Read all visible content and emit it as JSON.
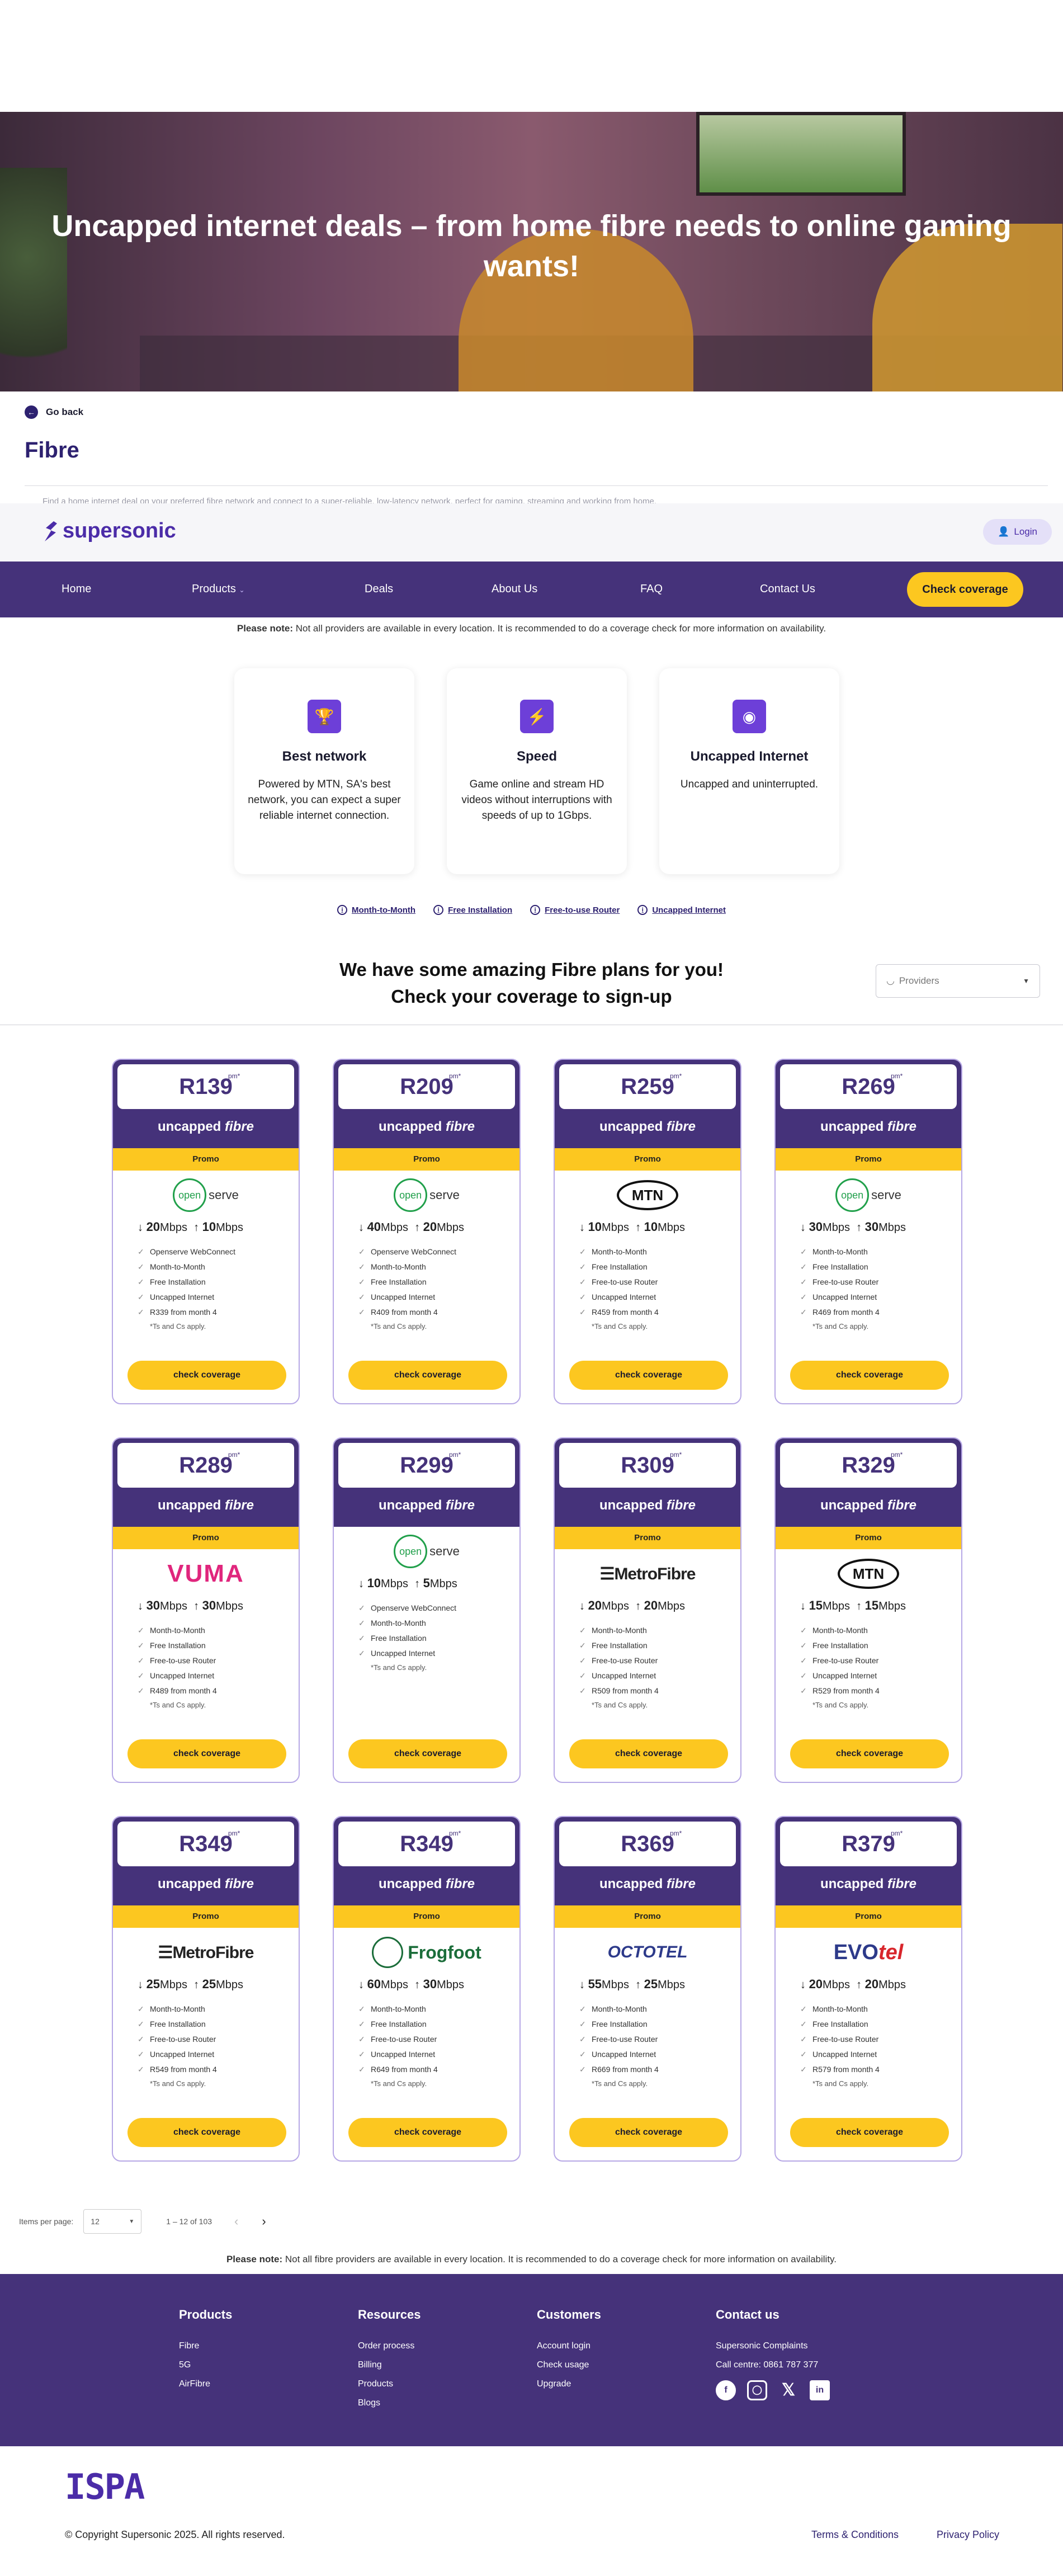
{
  "hero": {
    "title": "Uncapped internet deals – from home fibre needs to online gaming wants!"
  },
  "back": {
    "label": "Go back"
  },
  "page": {
    "title": "Fibre",
    "intro": "Find a home internet deal on your preferred fibre network and connect to a super-reliable, low-latency network, perfect for gaming, streaming and working from home."
  },
  "header": {
    "brand": "supersonic",
    "login": "Login",
    "nav": [
      "Home",
      "Products",
      "Deals",
      "About Us",
      "FAQ",
      "Contact Us"
    ],
    "cta": "Check coverage"
  },
  "note": {
    "strong": "Please note:",
    "text": " Not all providers are available in every location. It is recommended to do a coverage check for more information on availability."
  },
  "features": [
    {
      "icon": "trophy-icon",
      "title": "Best network",
      "text": "Powered by MTN, SA's best network, you can expect a super reliable internet connection."
    },
    {
      "icon": "lightning-icon",
      "title": "Speed",
      "text": "Game online and stream HD videos without interruptions with speeds of up to 1Gbps."
    },
    {
      "icon": "camera-icon",
      "title": "Uncapped Internet",
      "text": "Uncapped and uninterrupted."
    }
  ],
  "badges": [
    "Month-to-Month",
    "Free Installation",
    "Free-to-use Router",
    "Uncapped Internet"
  ],
  "plans_heading": {
    "line1": "We have some amazing Fibre plans for you!",
    "line2": "Check your coverage to sign-up"
  },
  "filter": {
    "placeholder": "Providers"
  },
  "card_common": {
    "plan": "uncapped",
    "plan_em": "fibre",
    "promo": "Promo",
    "cta": "check coverage",
    "pm": "pm*",
    "tcs": "*Ts and Cs apply."
  },
  "cards": [
    {
      "price": "R139",
      "provider": "openserve",
      "down": "20",
      "up": "10",
      "promo": true,
      "features": [
        "Openserve WebConnect",
        "Month-to-Month",
        "Free Installation",
        "Uncapped Internet",
        "R339 from month 4"
      ]
    },
    {
      "price": "R209",
      "provider": "openserve",
      "down": "40",
      "up": "20",
      "promo": true,
      "features": [
        "Openserve WebConnect",
        "Month-to-Month",
        "Free Installation",
        "Uncapped Internet",
        "R409 from month 4"
      ]
    },
    {
      "price": "R259",
      "provider": "mtn",
      "down": "10",
      "up": "10",
      "promo": true,
      "features": [
        "Month-to-Month",
        "Free Installation",
        "Free-to-use Router",
        "Uncapped Internet",
        "R459 from month 4"
      ]
    },
    {
      "price": "R269",
      "provider": "openserve",
      "down": "30",
      "up": "30",
      "promo": true,
      "features": [
        "Month-to-Month",
        "Free Installation",
        "Free-to-use Router",
        "Uncapped Internet",
        "R469 from month 4"
      ]
    },
    {
      "price": "R289",
      "provider": "vuma",
      "down": "30",
      "up": "30",
      "promo": true,
      "features": [
        "Month-to-Month",
        "Free Installation",
        "Free-to-use Router",
        "Uncapped Internet",
        "R489 from month 4"
      ]
    },
    {
      "price": "R299",
      "provider": "openserve",
      "down": "10",
      "up": "5",
      "promo": false,
      "features": [
        "Openserve WebConnect",
        "Month-to-Month",
        "Free Installation",
        "Uncapped Internet"
      ]
    },
    {
      "price": "R309",
      "provider": "metrofibre",
      "down": "20",
      "up": "20",
      "promo": true,
      "features": [
        "Month-to-Month",
        "Free Installation",
        "Free-to-use Router",
        "Uncapped Internet",
        "R509 from month 4"
      ]
    },
    {
      "price": "R329",
      "provider": "mtn",
      "down": "15",
      "up": "15",
      "promo": true,
      "features": [
        "Month-to-Month",
        "Free Installation",
        "Free-to-use Router",
        "Uncapped Internet",
        "R529 from month 4"
      ]
    },
    {
      "price": "R349",
      "provider": "metrofibre",
      "down": "25",
      "up": "25",
      "promo": true,
      "features": [
        "Month-to-Month",
        "Free Installation",
        "Free-to-use Router",
        "Uncapped Internet",
        "R549 from month 4"
      ]
    },
    {
      "price": "R349",
      "provider": "frogfoot",
      "down": "60",
      "up": "30",
      "promo": true,
      "features": [
        "Month-to-Month",
        "Free Installation",
        "Free-to-use Router",
        "Uncapped Internet",
        "R649 from month 4"
      ]
    },
    {
      "price": "R369",
      "provider": "octotel",
      "down": "55",
      "up": "25",
      "promo": true,
      "features": [
        "Month-to-Month",
        "Free Installation",
        "Free-to-use Router",
        "Uncapped Internet",
        "R669 from month 4"
      ]
    },
    {
      "price": "R379",
      "provider": "evotel",
      "down": "20",
      "up": "20",
      "promo": true,
      "features": [
        "Month-to-Month",
        "Free Installation",
        "Free-to-use Router",
        "Uncapped Internet",
        "R579 from month 4"
      ]
    }
  ],
  "logos": {
    "openserve_ring": "open",
    "openserve_text": "serve",
    "mtn": "MTN",
    "vuma": "VUMA",
    "metrofibre": "MetroFibre",
    "frogfoot": "Frogfoot",
    "octotel": "OCTOTEL",
    "evotel_a": "EVO",
    "evotel_b": "tel"
  },
  "unit": "Mbps",
  "pager": {
    "label": "Items per page:",
    "value": "12",
    "range": "1 – 12 of 103"
  },
  "note_bottom": {
    "strong": "Please note:",
    "text": " Not all fibre providers are available in every location. It is recommended to do a coverage check for more information on availability."
  },
  "footer": {
    "products": {
      "title": "Products",
      "items": [
        "Fibre",
        "5G",
        "AirFibre"
      ]
    },
    "resources": {
      "title": "Resources",
      "items": [
        "Order process",
        "Billing",
        "Products",
        "Blogs"
      ]
    },
    "customers": {
      "title": "Customers",
      "items": [
        "Account login",
        "Check usage",
        "Upgrade"
      ]
    },
    "contact": {
      "title": "Contact us",
      "items": [
        "Supersonic Complaints",
        "Call centre: 0861 787 377"
      ]
    }
  },
  "ispa": "ISPA",
  "copyright": "© Copyright Supersonic 2025. All rights reserved.",
  "legal": {
    "terms": "Terms & Conditions",
    "privacy": "Privacy Policy"
  },
  "colors": {
    "primary": "#45327A",
    "accent": "#FCC720",
    "brand": "#4B2CA8"
  }
}
